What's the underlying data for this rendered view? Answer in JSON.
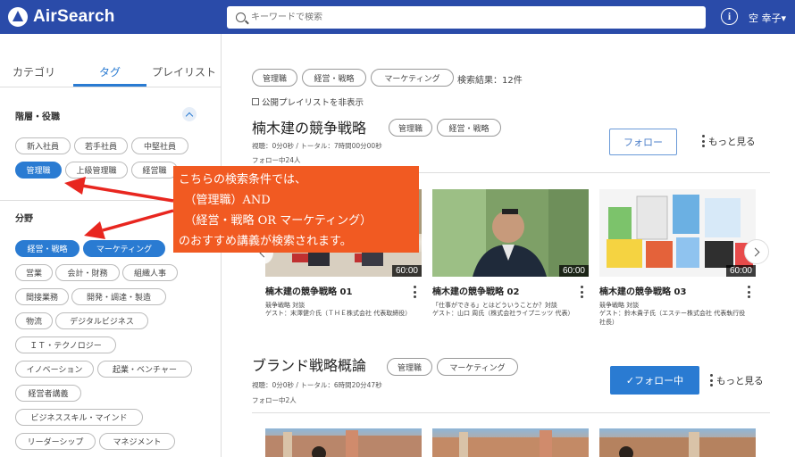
{
  "header": {
    "logo_text": "AirSearch",
    "search_placeholder": "キーワードで検索",
    "user_name": "空 幸子▾"
  },
  "sidebar": {
    "tabs": [
      "カテゴリ",
      "タグ",
      "プレイリスト"
    ],
    "active_tab": "タグ",
    "sections": [
      {
        "title": "階層・役職",
        "tags": [
          "新入社員",
          "若手社員",
          "中堅社員",
          "管理職",
          "上級管理職",
          "経営職"
        ],
        "active": [
          "管理職"
        ]
      },
      {
        "title": "分野",
        "tags": [
          "経営・戦略",
          "マーケティング",
          "営業",
          "会計・財務",
          "組織人事",
          "間接業務",
          "開発・調達・製造",
          "物流",
          "デジタルビジネス",
          "ＩＴ・テクノロジー",
          "イノベーション",
          "起業・ベンチャー",
          "経営者講義",
          "ビジネススキル・マインド",
          "リーダーシップ",
          "マネジメント"
        ],
        "active": [
          "経営・戦略",
          "マーケティング"
        ]
      }
    ]
  },
  "callout": {
    "lines": [
      "こちらの検索条件では、",
      "　（管理職）AND",
      "　（経営・戦略 OR マーケティング）",
      "のおすすめ講義が検索されます。"
    ]
  },
  "main": {
    "selected_tags": [
      "管理職",
      "経営・戦略",
      "マーケティング"
    ],
    "result_count": "検索結果：12件",
    "public_playlist_toggle": "公開プレイリストを非表示",
    "playlists": [
      {
        "title": "楠木建の競争戦略",
        "tags": [
          "管理職",
          "経営・戦略"
        ],
        "stats": "視聴：0分0秒 / トータル：7時間00分00秒",
        "followers": "フォロー中24人",
        "follow_label": "フォロー",
        "more_label": "もっと見る",
        "videos": [
          {
            "title": "楠木建の競争戦略 01",
            "duration": "60:00",
            "line1": "競争戦略 対談",
            "line2": "ゲスト：末澤健介氏（ＴＨＥ株式会社 代表取締役）"
          },
          {
            "title": "楠木建の競争戦略 02",
            "duration": "60:00",
            "line1": "「仕事ができる」とはどういうことか？対談",
            "line2": "ゲスト：山口 周氏（株式会社ライプニッツ 代表）"
          },
          {
            "title": "楠木建の競争戦略 03",
            "duration": "60:00",
            "line1": "競争戦略 対談",
            "line2": "ゲスト：鈴木貴子氏（エステー株式会社 代表執行役社長）"
          }
        ]
      },
      {
        "title": "ブランド戦略概論",
        "tags": [
          "管理職",
          "マーケティング"
        ],
        "stats": "視聴：0分0秒 / トータル：6時間20分47秒",
        "followers": "フォロー中2人",
        "follow_label": "✓フォロー中",
        "more_label": "もっと見る"
      }
    ]
  },
  "colors": {
    "header_bg": "#2a4ba9",
    "accent": "#2a7bd2",
    "callout_bg": "#f15a22",
    "arrow": "#e8261f"
  }
}
